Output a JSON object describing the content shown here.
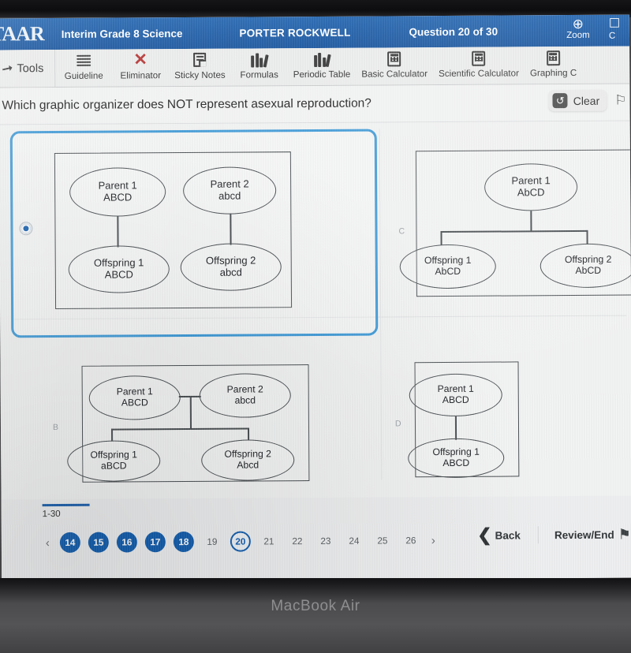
{
  "device": {
    "label": "MacBook Air"
  },
  "topbar": {
    "brand": "TAAR",
    "test_title": "Interim Grade 8 Science",
    "student_name": "PORTER ROCKWELL",
    "question_counter": "Question 20 of 30",
    "zoom_label": "Zoom",
    "zoom_icon": "magnifier-plus-icon",
    "cut_label": "C",
    "accent_blue": "#1560b0"
  },
  "toolbar": {
    "tools_label": "Tools",
    "tools_icon": "pointer-arrow-icon",
    "items": [
      {
        "label": "Guideline",
        "icon": "guideline-lines-icon"
      },
      {
        "label": "Eliminator",
        "icon": "red-x-icon"
      },
      {
        "label": "Sticky Notes",
        "icon": "sticky-note-icon"
      },
      {
        "label": "Formulas",
        "icon": "books-icon"
      },
      {
        "label": "Periodic Table",
        "icon": "books-icon"
      },
      {
        "label": "Basic Calculator",
        "icon": "calculator-icon"
      },
      {
        "label": "Scientific Calculator",
        "icon": "calculator-icon"
      },
      {
        "label": "Graphing C",
        "icon": "calculator-icon"
      }
    ]
  },
  "question": {
    "text": "Which graphic organizer does NOT represent asexual reproduction?",
    "clear_label": "Clear",
    "clear_icon": "undo-circular-arrow-icon",
    "flag_icon": "flag-outline-icon"
  },
  "options": {
    "a": {
      "letter": "",
      "selected": true,
      "nodes": {
        "parent1": {
          "line1": "Parent 1",
          "line2": "ABCD"
        },
        "parent2": {
          "line1": "Parent 2",
          "line2": "abcd"
        },
        "offspring1": {
          "line1": "Offspring 1",
          "line2": "ABCD"
        },
        "offspring2": {
          "line1": "Offspring 2",
          "line2": "abcd"
        }
      }
    },
    "c": {
      "letter": "C",
      "selected": false,
      "nodes": {
        "parent1": {
          "line1": "Parent 1",
          "line2": "AbCD"
        },
        "offspring1": {
          "line1": "Offspring 1",
          "line2": "AbCD"
        },
        "offspring2": {
          "line1": "Offspring 2",
          "line2": "AbCD"
        }
      }
    },
    "b": {
      "letter": "B",
      "selected": false,
      "nodes": {
        "parent1": {
          "line1": "Parent 1",
          "line2": "ABCD"
        },
        "parent2": {
          "line1": "Parent 2",
          "line2": "abcd"
        },
        "offspring1": {
          "line1": "Offspring 1",
          "line2": "aBCD"
        },
        "offspring2": {
          "line1": "Offspring 2",
          "line2": "Abcd"
        }
      }
    },
    "d": {
      "letter": "D",
      "selected": false,
      "nodes": {
        "parent1": {
          "line1": "Parent 1",
          "line2": "ABCD"
        },
        "offspring1": {
          "line1": "Offspring 1",
          "line2": "ABCD"
        }
      }
    }
  },
  "bottom": {
    "progress_label": "1-30",
    "prev_icon": "chevron-left-icon",
    "next_icon": "chevron-right-icon",
    "pages": [
      {
        "n": "14",
        "state": "done"
      },
      {
        "n": "15",
        "state": "done"
      },
      {
        "n": "16",
        "state": "done"
      },
      {
        "n": "17",
        "state": "done"
      },
      {
        "n": "18",
        "state": "done"
      },
      {
        "n": "19",
        "state": "plain"
      },
      {
        "n": "20",
        "state": "current"
      },
      {
        "n": "21",
        "state": "plain"
      },
      {
        "n": "22",
        "state": "plain"
      },
      {
        "n": "23",
        "state": "plain"
      },
      {
        "n": "24",
        "state": "plain"
      },
      {
        "n": "25",
        "state": "plain"
      },
      {
        "n": "26",
        "state": "plain"
      }
    ],
    "back_label": "Back",
    "back_icon": "chevron-left-icon",
    "review_label": "Review/End",
    "review_icon": "flag-filled-icon"
  }
}
